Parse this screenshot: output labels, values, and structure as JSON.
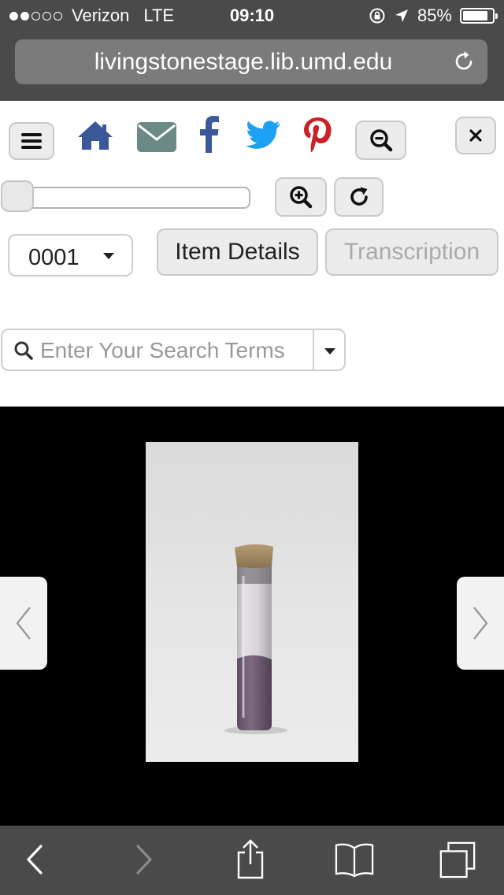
{
  "status_bar": {
    "carrier": "Verizon",
    "network": "LTE",
    "time": "09:10",
    "battery": "85%",
    "battery_level": 0.85,
    "signal_bars_filled": 2,
    "signal_bars_total": 5
  },
  "browser": {
    "url": "livingstonestage.lib.umd.edu",
    "reload_icon": "reload-icon"
  },
  "toolbar": {
    "menu_icon": "hamburger-menu-icon",
    "home_icon": "home-icon",
    "email_icon": "envelope-icon",
    "facebook_icon": "facebook-icon",
    "twitter_icon": "twitter-icon",
    "pinterest_icon": "pinterest-icon",
    "zoom_out_icon": "zoom-out-icon",
    "close_icon": "close-icon",
    "zoom_in_icon": "zoom-in-icon",
    "rotate_icon": "rotate-icon",
    "zoom_slider_level": 0
  },
  "page_selector": {
    "value": "0001"
  },
  "tabs": {
    "item_details": "Item Details",
    "transcription": "Transcription"
  },
  "search": {
    "placeholder": "Enter Your Search Terms",
    "value": ""
  },
  "viewer": {
    "prev_icon": "chevron-left-icon",
    "next_icon": "chevron-right-icon"
  },
  "safari_toolbar": {
    "back_icon": "back-icon",
    "forward_icon": "forward-icon",
    "share_icon": "share-icon",
    "bookmarks_icon": "bookmarks-icon",
    "tabs_icon": "tabs-icon"
  },
  "colors": {
    "chrome": "#4a4a4a",
    "home": "#3b5998",
    "email": "#6b8a86",
    "facebook": "#3b5998",
    "twitter": "#1da1f2",
    "pinterest": "#cb2027"
  }
}
